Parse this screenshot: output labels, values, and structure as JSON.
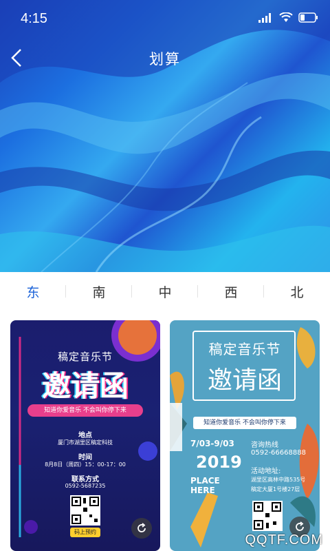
{
  "status_bar": {
    "time": "4:15"
  },
  "header": {
    "title": "划算"
  },
  "tabs": [
    {
      "label": "东",
      "active": true
    },
    {
      "label": "南",
      "active": false
    },
    {
      "label": "中",
      "active": false
    },
    {
      "label": "西",
      "active": false
    },
    {
      "label": "北",
      "active": false
    }
  ],
  "cards": {
    "left": {
      "title_small": "稿定音乐节",
      "title_big": "邀请函",
      "tagline": "知道你爱音乐  不会叫你停下来",
      "location_label": "地点",
      "location_value": "厦门市湖里区稿定科技",
      "time_label": "时间",
      "time_value": "8月8日（周四）15：00-17：00",
      "contact_label": "联系方式",
      "contact_value": "0592-5687235",
      "qr_caption": "码上预约"
    },
    "right": {
      "title_small": "稿定音乐节",
      "title_big": "邀请函",
      "tagline": "知道你爱音乐  不会叫你停下来",
      "dates": "7/03-9/03",
      "year": "2019",
      "place": "PLACE HERE",
      "hotline_label": "咨询热线",
      "hotline_value": "0592-66668888",
      "address_label": "活动地址:",
      "address_line1": "湖里区高林中路535号",
      "address_line2": "稿定大厦1号楼27层"
    }
  },
  "watermark": "QQTF.COM",
  "colors": {
    "accent": "#1a62d8",
    "tab_text": "#333333",
    "card_left_bg": "#1a2172",
    "card_right_bg": "#54a3c4"
  }
}
